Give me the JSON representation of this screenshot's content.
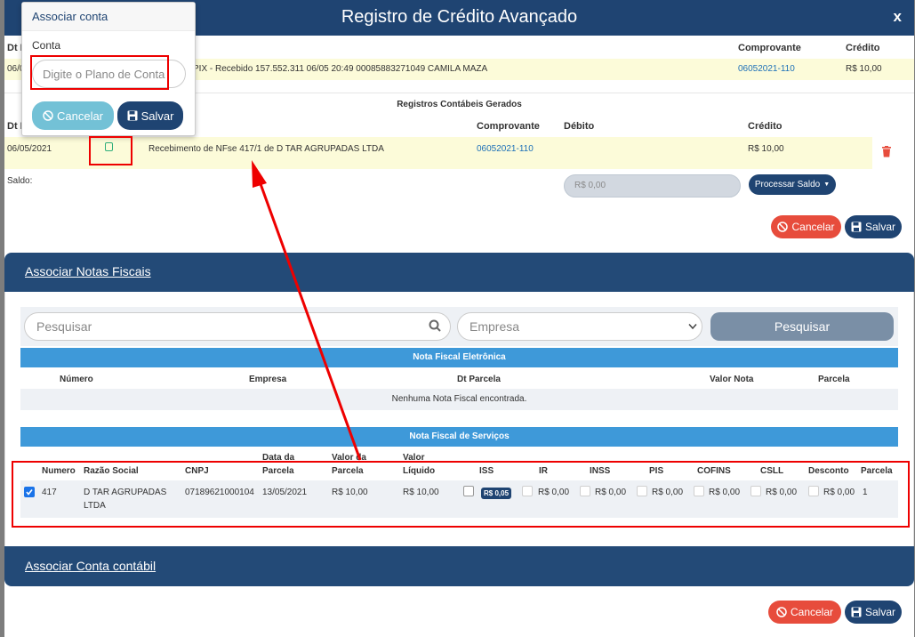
{
  "modal": {
    "title": "Registro de Crédito Avançado",
    "close": "x"
  },
  "top_table": {
    "headers": {
      "dt": "Dt L",
      "comprovante": "Comprovante",
      "credito": "Crédito"
    },
    "row": {
      "dt": "06/0",
      "desc": "PIX - Recebido 157.552.311 06/05 20:49 00085883271049 CAMILA MAZA",
      "comprovante": "06052021-110",
      "credito": "R$ 10,00"
    }
  },
  "registros": {
    "title": "Registros Contábeis Gerados",
    "headers": {
      "dt": "Dt L",
      "comprovante": "Comprovante",
      "debito": "Débito",
      "credito": "Crédito"
    },
    "row": {
      "dt": "06/05/2021",
      "desc": "Recebimento de NFse 417/1 de D TAR AGRUPADAS LTDA",
      "comprovante": "06052021-110",
      "credito": "R$ 10,00"
    },
    "saldo_label": "Saldo:",
    "saldo_value": "R$ 0,00",
    "processar_label": "Processar Saldo"
  },
  "actions": {
    "cancel": "Cancelar",
    "save": "Salvar"
  },
  "notas": {
    "section_title": "Associar Notas Fiscais",
    "search_placeholder": "Pesquisar",
    "empresa_placeholder": "Empresa",
    "search_button": "Pesquisar",
    "nfe": {
      "title": "Nota Fiscal Eletrônica",
      "headers": {
        "numero": "Número",
        "empresa": "Empresa",
        "dt_parcela": "Dt Parcela",
        "valor_nota": "Valor Nota",
        "parcela": "Parcela"
      },
      "empty": "Nenhuma Nota Fiscal encontrada."
    },
    "nfs": {
      "title": "Nota Fiscal de Serviços",
      "headers": {
        "numero": "Numero",
        "razao": "Razão Social",
        "cnpj": "CNPJ",
        "data1": "Data da",
        "data2": "Parcela",
        "valor1": "Valor da",
        "valor2": "Parcela",
        "liquido1": "Valor",
        "liquido2": "Líquido",
        "iss": "ISS",
        "ir": "IR",
        "inss": "INSS",
        "pis": "PIS",
        "cofins": "COFINS",
        "csll": "CSLL",
        "desconto": "Desconto",
        "parcela": "Parcela"
      },
      "row": {
        "numero": "417",
        "razao1": "D TAR AGRUPADAS",
        "razao2": "LTDA",
        "cnpj": "07189621000104",
        "data": "13/05/2021",
        "valor": "R$ 10,00",
        "liquido": "R$ 10,00",
        "iss_badge": "R$ 0,05",
        "ir": "R$ 0,00",
        "inss": "R$ 0,00",
        "pis": "R$ 0,00",
        "cofins": "R$ 0,00",
        "csll": "R$ 0,00",
        "desconto": "R$ 0,00",
        "parcela": "1"
      }
    }
  },
  "conta_section": {
    "title": "Associar Conta contábil"
  },
  "popover": {
    "title": "Associar conta",
    "conta_label": "Conta",
    "placeholder": "Digite o Plano de Conta",
    "cancel": "Cancelar",
    "save": "Salvar"
  },
  "colors": {
    "navy": "#1f4472",
    "red": "#e74c3c",
    "blue_bar": "#3e99d9",
    "highlight": "#e00000"
  }
}
